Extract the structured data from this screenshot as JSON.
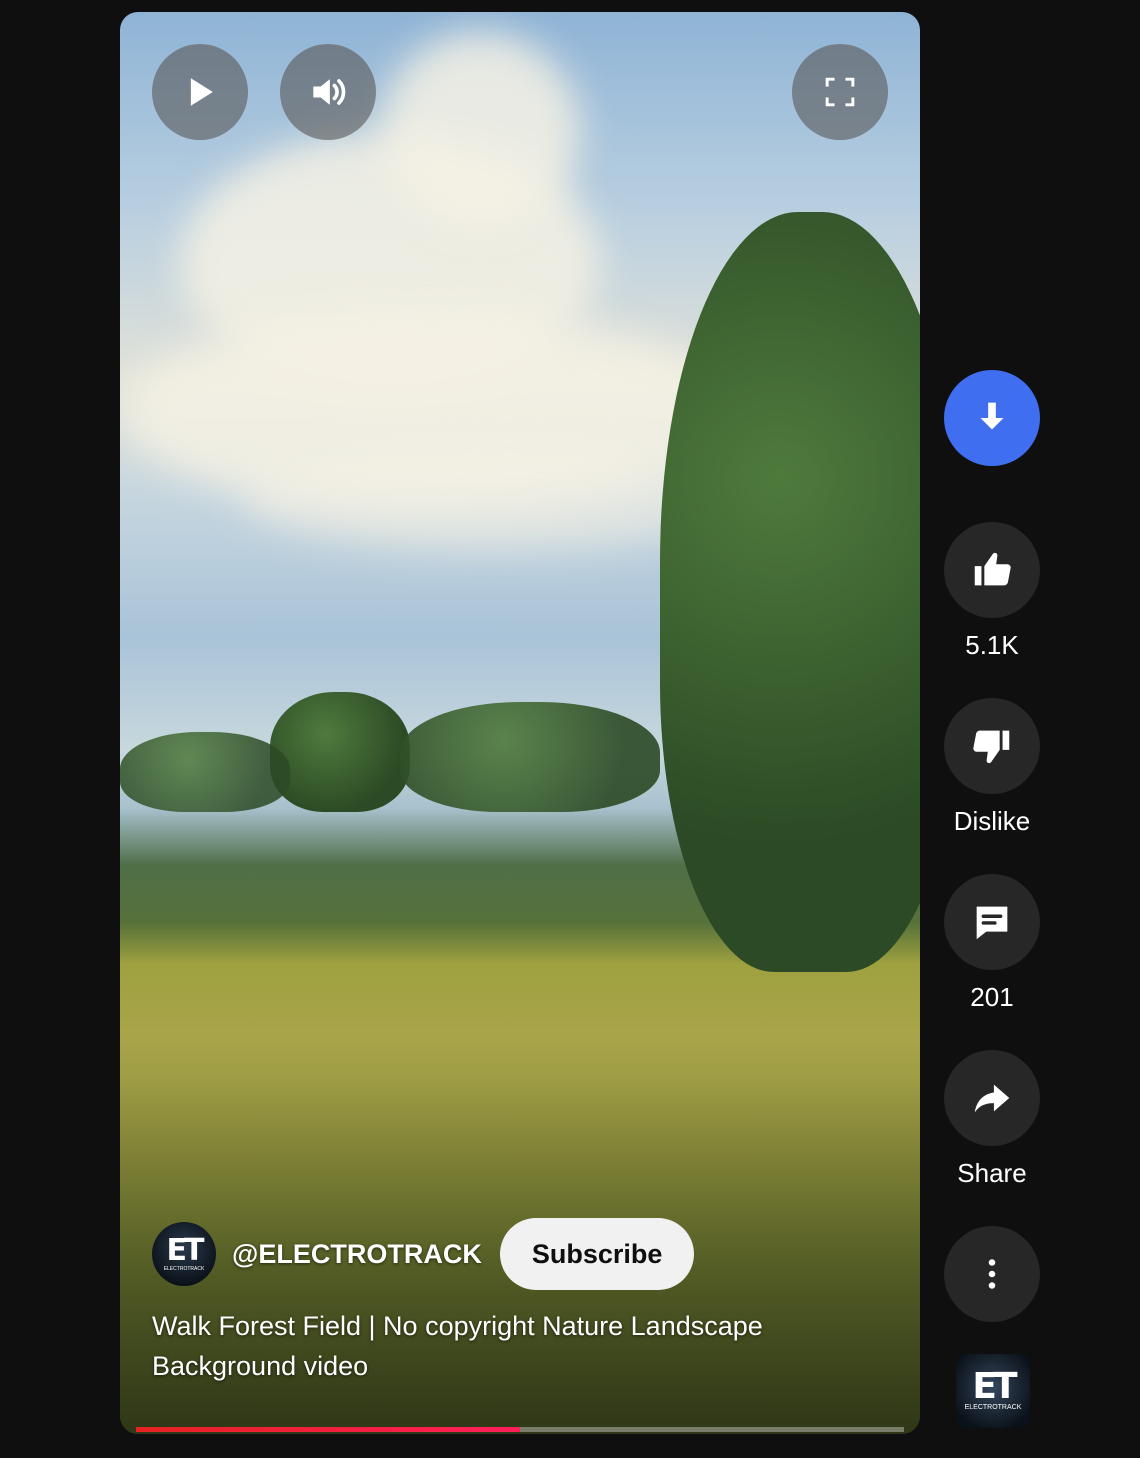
{
  "player": {
    "progress_fraction": 0.5
  },
  "channel": {
    "handle": "@ELECTROTRACK",
    "logo_text": "ET",
    "logo_subtext": "ELECTROTRACK",
    "subscribe_label": "Subscribe"
  },
  "video": {
    "title": "Walk Forest Field | No copyright Nature Landscape Background video"
  },
  "actions": {
    "like_count": "5.1K",
    "dislike_label": "Dislike",
    "comment_count": "201",
    "share_label": "Share"
  },
  "colors": {
    "download_accent": "#3f6ef0",
    "progress": "#e52222",
    "action_bg": "#272727"
  }
}
